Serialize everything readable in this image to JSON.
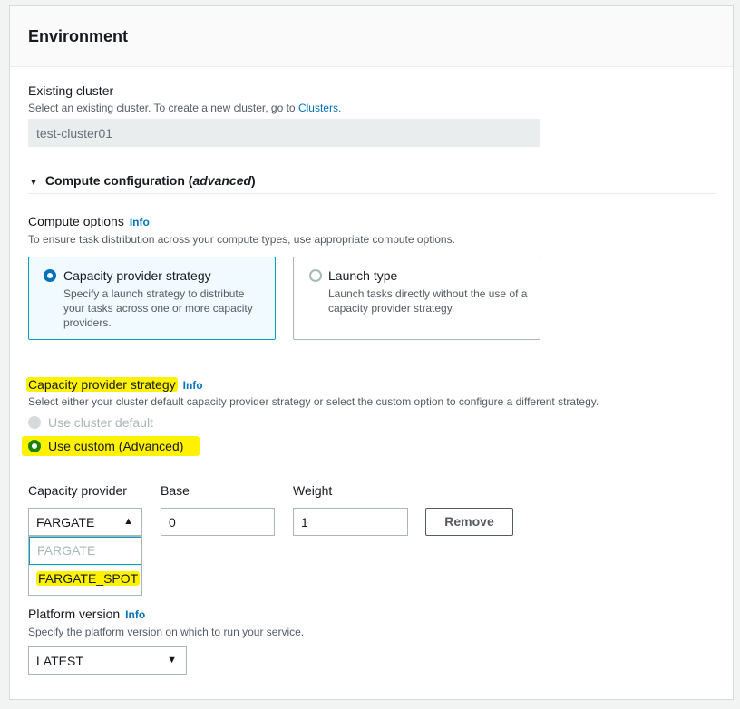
{
  "panel": {
    "title": "Environment"
  },
  "existing_cluster": {
    "label": "Existing cluster",
    "desc_prefix": "Select an existing cluster. To create a new cluster, go to ",
    "desc_link": "Clusters",
    "desc_suffix": ".",
    "value": "test-cluster01"
  },
  "compute_config": {
    "prefix": "Compute configuration (",
    "italic": "advanced",
    "suffix": ")"
  },
  "compute_options": {
    "label": "Compute options",
    "info": "Info",
    "desc": "To ensure task distribution across your compute types, use appropriate compute options.",
    "tiles": [
      {
        "title": "Capacity provider strategy",
        "desc": "Specify a launch strategy to distribute your tasks across one or more capacity providers.",
        "selected": true
      },
      {
        "title": "Launch type",
        "desc": "Launch tasks directly without the use of a capacity provider strategy.",
        "selected": false
      }
    ]
  },
  "cps": {
    "label": "Capacity provider strategy",
    "info": "Info",
    "desc": "Select either your cluster default capacity provider strategy or select the custom option to configure a different strategy.",
    "opt_default": "Use cluster default",
    "opt_custom": "Use custom (Advanced)"
  },
  "provider_row": {
    "col_provider": "Capacity provider",
    "col_base": "Base",
    "col_weight": "Weight",
    "provider_value": "FARGATE",
    "base_value": "0",
    "weight_value": "1",
    "remove": "Remove",
    "options": [
      "FARGATE",
      "FARGATE_SPOT"
    ]
  },
  "platform": {
    "label": "Platform version",
    "info": "Info",
    "desc": "Specify the platform version on which to run your service.",
    "value": "LATEST"
  },
  "colors": {
    "accent": "#0073bb",
    "highlight": "#fff200",
    "selected_border": "#00a1c9"
  }
}
